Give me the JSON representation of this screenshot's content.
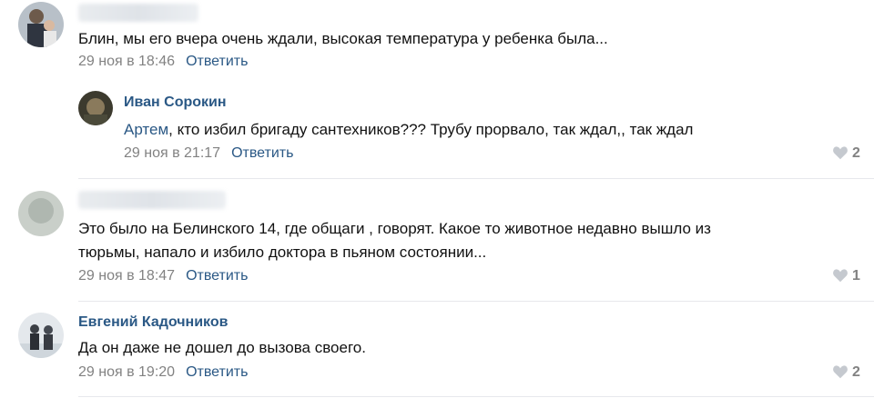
{
  "comments": [
    {
      "text": "Блин, мы его вчера очень ждали, высокая температура у ребенка была...",
      "date": "29 ноя в 18:46",
      "reply_label": "Ответить"
    },
    {
      "author": "Иван Сорокин",
      "mention": "Артем",
      "text": ", кто избил бригаду сантехников??? Трубу прорвало, так ждал,, так ждал",
      "date": "29 ноя в 21:17",
      "reply_label": "Ответить",
      "likes": "2"
    },
    {
      "text_line1": "Это было на Белинского 14, где общаги , говорят. Какое то животное недавно вышло из",
      "text_line2": "тюрьмы, напало и избило доктора в пьяном состоянии...",
      "date": "29 ноя в 18:47",
      "reply_label": "Ответить",
      "likes": "1"
    },
    {
      "author": "Евгений Кадочников",
      "text": "Да он даже не дошел до вызова своего.",
      "date": "29 ноя в 19:20",
      "reply_label": "Ответить",
      "likes": "2"
    }
  ],
  "colors": {
    "link": "#2a5885",
    "meta": "#828282",
    "separator": "#e7e8ec"
  }
}
